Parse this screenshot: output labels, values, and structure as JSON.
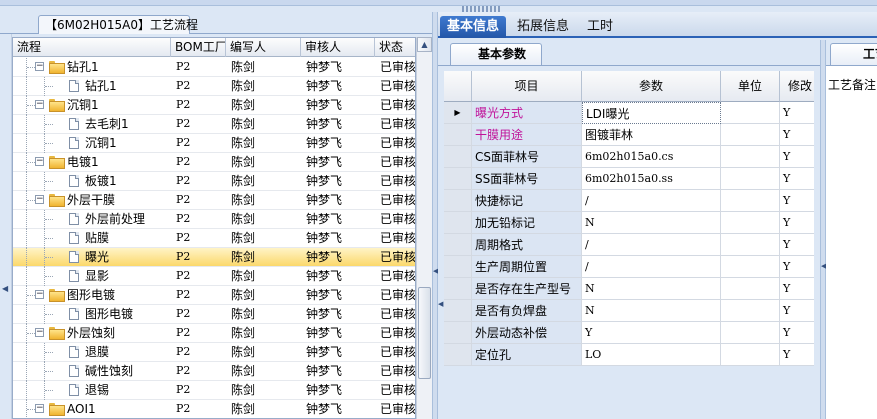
{
  "left_panel": {
    "tab_title": "【6M02H015A0】工艺流程",
    "columns": [
      "流程",
      "BOM工厂",
      "编写人",
      "审核人",
      "状态"
    ],
    "rows": [
      {
        "name": "钻孔1",
        "level": 0,
        "folder": true,
        "expanded": true,
        "bom": "P2",
        "author": "陈剑",
        "reviewer": "钟梦飞",
        "status": "已审核"
      },
      {
        "name": "钻孔1",
        "level": 1,
        "folder": false,
        "bom": "P2",
        "author": "陈剑",
        "reviewer": "钟梦飞",
        "status": "已审核"
      },
      {
        "name": "沉铜1",
        "level": 0,
        "folder": true,
        "expanded": true,
        "bom": "P2",
        "author": "陈剑",
        "reviewer": "钟梦飞",
        "status": "已审核"
      },
      {
        "name": "去毛刺1",
        "level": 1,
        "folder": false,
        "bom": "P2",
        "author": "陈剑",
        "reviewer": "钟梦飞",
        "status": "已审核"
      },
      {
        "name": "沉铜1",
        "level": 1,
        "folder": false,
        "bom": "P2",
        "author": "陈剑",
        "reviewer": "钟梦飞",
        "status": "已审核"
      },
      {
        "name": "电镀1",
        "level": 0,
        "folder": true,
        "expanded": true,
        "bom": "P2",
        "author": "陈剑",
        "reviewer": "钟梦飞",
        "status": "已审核"
      },
      {
        "name": "板镀1",
        "level": 1,
        "folder": false,
        "bom": "P2",
        "author": "陈剑",
        "reviewer": "钟梦飞",
        "status": "已审核"
      },
      {
        "name": "外层干膜",
        "level": 0,
        "folder": true,
        "expanded": true,
        "bom": "P2",
        "author": "陈剑",
        "reviewer": "钟梦飞",
        "status": "已审核"
      },
      {
        "name": "外层前处理",
        "level": 1,
        "folder": false,
        "bom": "P2",
        "author": "陈剑",
        "reviewer": "钟梦飞",
        "status": "已审核"
      },
      {
        "name": "贴膜",
        "level": 1,
        "folder": false,
        "bom": "P2",
        "author": "陈剑",
        "reviewer": "钟梦飞",
        "status": "已审核"
      },
      {
        "name": "曝光",
        "level": 1,
        "folder": false,
        "selected": true,
        "bom": "P2",
        "author": "陈剑",
        "reviewer": "钟梦飞",
        "status": "已审核"
      },
      {
        "name": "显影",
        "level": 1,
        "folder": false,
        "bom": "P2",
        "author": "陈剑",
        "reviewer": "钟梦飞",
        "status": "已审核"
      },
      {
        "name": "图形电镀",
        "level": 0,
        "folder": true,
        "expanded": true,
        "bom": "P2",
        "author": "陈剑",
        "reviewer": "钟梦飞",
        "status": "已审核"
      },
      {
        "name": "图形电镀",
        "level": 1,
        "folder": false,
        "bom": "P2",
        "author": "陈剑",
        "reviewer": "钟梦飞",
        "status": "已审核"
      },
      {
        "name": "外层蚀刻",
        "level": 0,
        "folder": true,
        "expanded": true,
        "bom": "P2",
        "author": "陈剑",
        "reviewer": "钟梦飞",
        "status": "已审核"
      },
      {
        "name": "退膜",
        "level": 1,
        "folder": false,
        "bom": "P2",
        "author": "陈剑",
        "reviewer": "钟梦飞",
        "status": "已审核"
      },
      {
        "name": "碱性蚀刻",
        "level": 1,
        "folder": false,
        "bom": "P2",
        "author": "陈剑",
        "reviewer": "钟梦飞",
        "status": "已审核"
      },
      {
        "name": "退锡",
        "level": 1,
        "folder": false,
        "bom": "P2",
        "author": "陈剑",
        "reviewer": "钟梦飞",
        "status": "已审核"
      },
      {
        "name": "AOI1",
        "level": 0,
        "folder": true,
        "expanded": true,
        "bom": "P2",
        "author": "陈剑",
        "reviewer": "钟梦飞",
        "status": "已审核"
      }
    ]
  },
  "tabs": [
    {
      "label": "基本信息",
      "active": true
    },
    {
      "label": "拓展信息",
      "active": false
    },
    {
      "label": "工时",
      "active": false
    }
  ],
  "param_panel": {
    "tab_title": "基本参数",
    "columns": [
      "项目",
      "参数",
      "单位",
      "修改"
    ],
    "rows": [
      {
        "item": "曝光方式",
        "value": "LDI曝光",
        "unit": "",
        "edit": "Y",
        "highlight": true,
        "current": true
      },
      {
        "item": "干膜用途",
        "value": "图镀菲林",
        "unit": "",
        "edit": "Y",
        "highlight": true
      },
      {
        "item": "CS面菲林号",
        "value": "6m02h015a0.cs",
        "unit": "",
        "edit": "Y"
      },
      {
        "item": "SS面菲林号",
        "value": "6m02h015a0.ss",
        "unit": "",
        "edit": "Y"
      },
      {
        "item": "快捷标记",
        "value": "/",
        "unit": "",
        "edit": "Y"
      },
      {
        "item": "加无铅标记",
        "value": "N",
        "unit": "",
        "edit": "Y"
      },
      {
        "item": "周期格式",
        "value": "/",
        "unit": "",
        "edit": "Y"
      },
      {
        "item": "生产周期位置",
        "value": "/",
        "unit": "",
        "edit": "Y"
      },
      {
        "item": "是否存在生产型号",
        "value": "N",
        "unit": "",
        "edit": "Y"
      },
      {
        "item": "是否有负焊盘",
        "value": "N",
        "unit": "",
        "edit": "Y"
      },
      {
        "item": "外层动态补偿",
        "value": "Y",
        "unit": "",
        "edit": "Y"
      },
      {
        "item": "定位孔",
        "value": "LO",
        "unit": "",
        "edit": "Y"
      }
    ]
  },
  "remark_panel": {
    "tab_title": "工艺备注",
    "label": "工艺备注"
  },
  "colors": {
    "highlight_item": "#c0139a",
    "active_tab": "#2356a8",
    "selected_row": "#fbd86b"
  }
}
